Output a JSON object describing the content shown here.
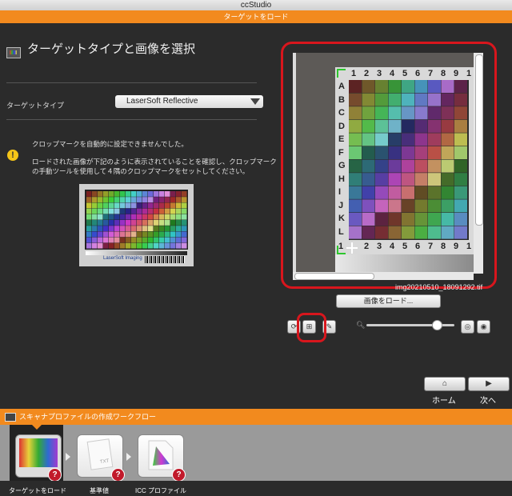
{
  "window": {
    "title": "ccStudio"
  },
  "step_bar": {
    "title": "ターゲットをロード"
  },
  "panel": {
    "heading": "ターゲットタイプと画像を選択",
    "target_type_label": "ターゲットタイプ",
    "target_type_value": "LaserSoft Reflective",
    "warning_line1": "クロップマークを自動的に設定できませんでした。",
    "warning_line2": "ロードされた画像が下記のように表示されていることを確認し、クロップマーク",
    "warning_line3": "の手動ツールを使用して４隅のクロップマークをセットしてください。",
    "thumb_brand": "LaserSoft",
    "thumb_brand_suffix": "Imaging"
  },
  "preview": {
    "columns": [
      "1",
      "2",
      "3",
      "4",
      "5",
      "6",
      "7",
      "8",
      "9",
      "1"
    ],
    "bottom_columns": [
      "2",
      "3",
      "4",
      "5",
      "6",
      "7",
      "8",
      "9",
      "1"
    ],
    "rows": [
      "A",
      "B",
      "C",
      "D",
      "E",
      "F",
      "G",
      "H",
      "I",
      "J",
      "K",
      "L"
    ],
    "bottom_left": "1",
    "filename": "img20210510_18091292.tif",
    "load_button": "画像をロード..."
  },
  "nav": {
    "home_label": "ホーム",
    "next_label": "次へ"
  },
  "workflow": {
    "title": "スキャナプロファイルの作成ワークフロー",
    "steps": [
      {
        "label": "ターゲットをロード"
      },
      {
        "label": "基準値"
      },
      {
        "label": "ICC プロファイル"
      }
    ],
    "doc_text": "TXT",
    "badge": "?"
  },
  "icons": {
    "target": "target-chart-icon",
    "warning": "warning-icon",
    "home": "home-icon",
    "next": "next-arrow-icon"
  },
  "colors": {
    "accent": "#f28a1e",
    "highlight": "#d8161d",
    "background": "#2b2b2b"
  }
}
